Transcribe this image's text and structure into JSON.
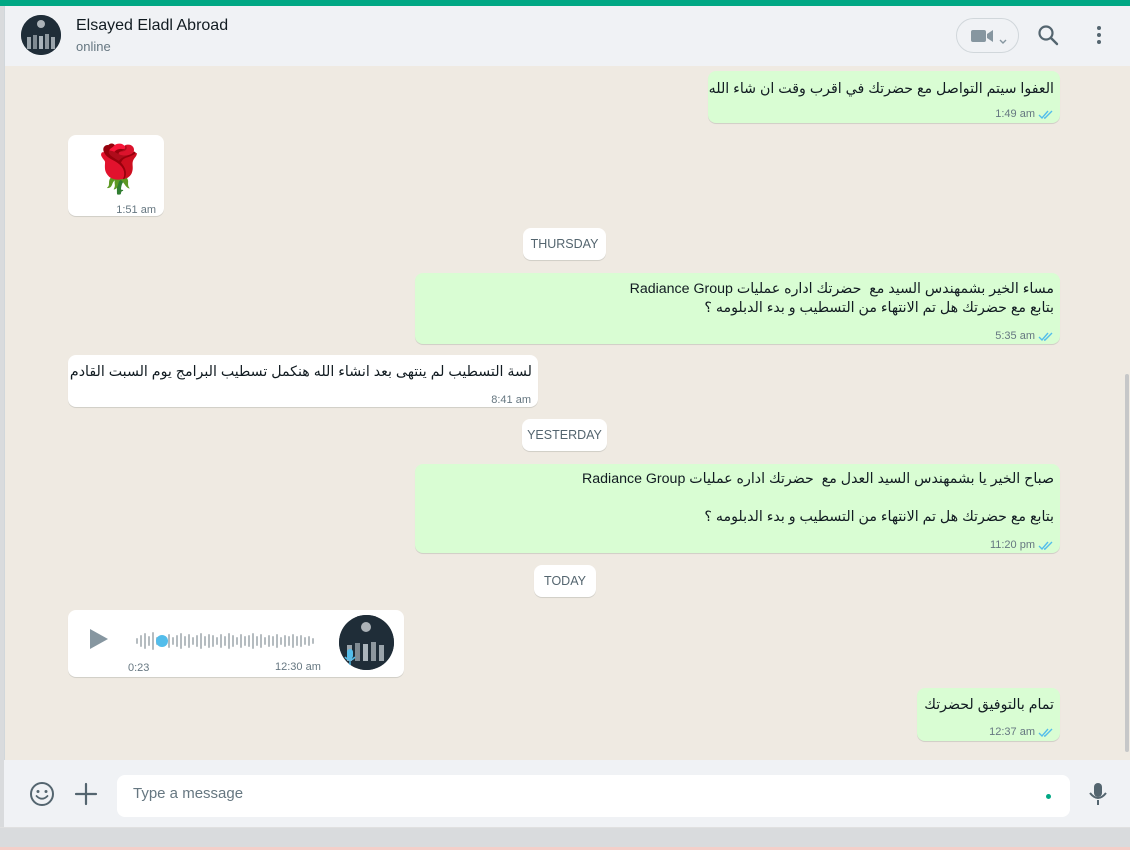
{
  "header": {
    "contact_name": "Elsayed Eladl Abroad",
    "status": "online"
  },
  "messages": [
    {
      "text": "العفوا سيتم التواصل مع حضرتك في اقرب وقت ان شاء الله",
      "time": "1:49 am"
    },
    {
      "text": "🌹",
      "time": "1:51 am"
    },
    {
      "text": "مساء الخير بشمهندس السيد مع  حضرتك اداره عمليات Radiance Group\nبتابع مع حضرتك هل تم الانتهاء من التسطيب و بدء الدبلومه ؟",
      "time": "5:35 am"
    },
    {
      "text": "لسة التسطيب لم ينتهى بعد انشاء الله هنكمل تسطيب البرامج يوم السبت القادم",
      "time": "8:41 am"
    },
    {
      "text": "صباح الخير يا بشمهندس السيد العدل مع  حضرتك اداره عمليات Radiance Group\n\nبتابع مع حضرتك هل تم الانتهاء من التسطيب و بدء الدبلومه ؟",
      "time": "11:20 pm"
    },
    {
      "duration": "0:23",
      "time": "12:30 am"
    },
    {
      "text": "تمام بالتوفيق لحضرتك",
      "time": "12:37 am"
    }
  ],
  "day_labels": [
    "THURSDAY",
    "YESTERDAY",
    "TODAY"
  ],
  "composer": {
    "placeholder": "Type a message"
  },
  "colors": {
    "accent": "#00a884",
    "outgoing_bubble": "#d9fdd3",
    "incoming_bubble": "#ffffff",
    "read_ticks": "#53bdeb",
    "chat_background": "#efeae2"
  },
  "icons": [
    "video-camera-icon",
    "chevron-down-icon",
    "search-icon",
    "menu-dots-icon",
    "emoji-icon",
    "plus-icon",
    "microphone-icon",
    "play-icon",
    "double-check-icon"
  ]
}
